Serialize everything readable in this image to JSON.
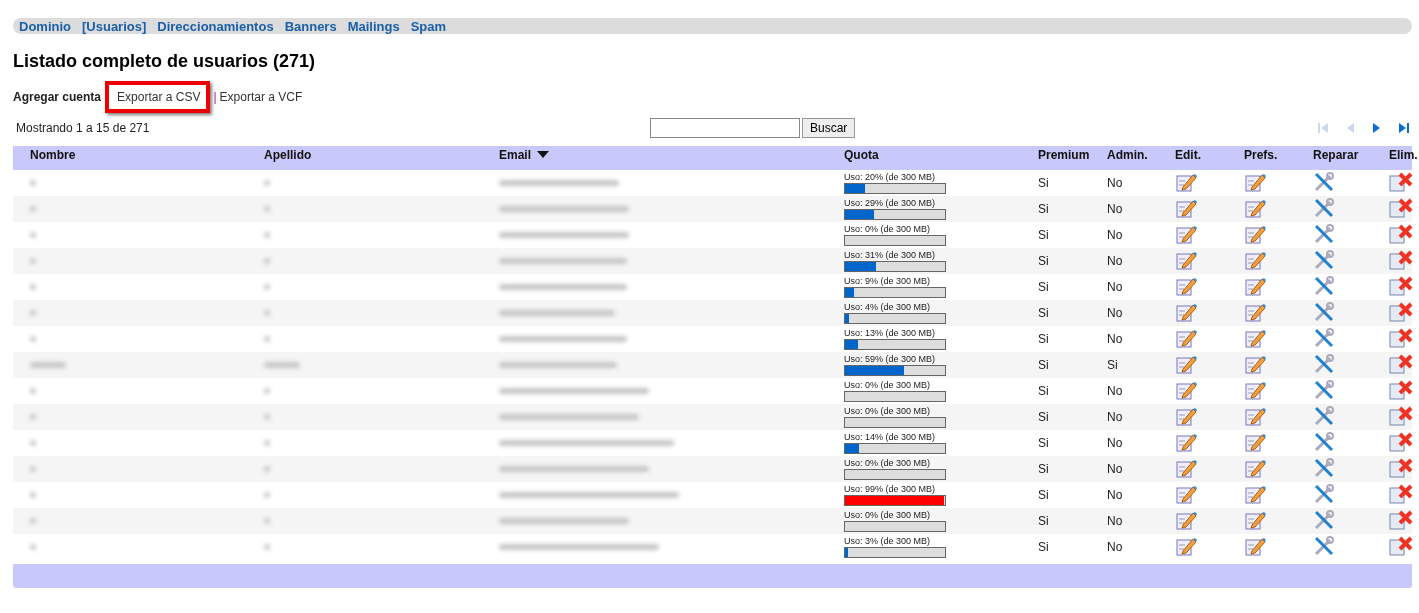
{
  "nav": [
    {
      "label": "Dominio"
    },
    {
      "label": "[Usuarios]"
    },
    {
      "label": "Direccionamientos"
    },
    {
      "label": "Banners"
    },
    {
      "label": "Mailings"
    },
    {
      "label": "Spam"
    }
  ],
  "title": "Listado completo de usuarios (271)",
  "actions": {
    "add": "Agregar cuenta",
    "export_csv": {
      "label": "Exportar a CSV",
      "highlighted": true
    },
    "separator": "|",
    "export_vcf": "Exportar a VCF"
  },
  "showing": "Mostrando 1 a 15 de 271",
  "search": {
    "button": "Buscar"
  },
  "pager": [
    {
      "kind": "first",
      "disabled": true
    },
    {
      "kind": "prev",
      "disabled": true
    },
    {
      "kind": "next",
      "disabled": false
    },
    {
      "kind": "last",
      "disabled": false
    }
  ],
  "table": {
    "columns": [
      {
        "label": "Nombre",
        "sorted": false
      },
      {
        "label": "Apellido",
        "sorted": false
      },
      {
        "label": "Email",
        "sorted": true
      },
      {
        "label": "Quota",
        "sorted": false
      },
      {
        "label": "Premium",
        "sorted": false
      },
      {
        "label": "Admin.",
        "sorted": false
      },
      {
        "label": "Edit.",
        "sorted": false
      },
      {
        "label": "Prefs.",
        "sorted": false
      },
      {
        "label": "Reparar",
        "sorted": false
      },
      {
        "label": "Elim.",
        "sorted": false
      }
    ],
    "rows": [
      {
        "quota": "Uso: 20% (de 300 MB)",
        "level": 0.2,
        "color": "#0066cc",
        "premium": "Si",
        "admin": "No"
      },
      {
        "quota": "Uso: 29% (de 300 MB)",
        "level": 0.29,
        "color": "#0066cc",
        "premium": "Si",
        "admin": "No"
      },
      {
        "quota": "Uso: 0% (de 300 MB)",
        "level": 0,
        "premium": "Si",
        "admin": "No"
      },
      {
        "quota": "Uso: 31% (de 300 MB)",
        "level": 0.31,
        "color": "#0066cc",
        "premium": "Si",
        "admin": "No"
      },
      {
        "quota": "Uso: 9% (de 300 MB)",
        "level": 0.09,
        "color": "#0066cc",
        "premium": "Si",
        "admin": "No"
      },
      {
        "quota": "Uso: 4% (de 300 MB)",
        "level": 0.04,
        "color": "#0066cc",
        "premium": "Si",
        "admin": "No"
      },
      {
        "quota": "Uso: 13% (de 300 MB)",
        "level": 0.13,
        "color": "#0066cc",
        "premium": "Si",
        "admin": "No"
      },
      {
        "quota": "Uso: 59% (de 300 MB)",
        "level": 0.59,
        "color": "#0066cc",
        "premium": "Si",
        "admin": "Si"
      },
      {
        "quota": "Uso: 0% (de 300 MB)",
        "level": 0,
        "premium": "Si",
        "admin": "No"
      },
      {
        "quota": "Uso: 0% (de 300 MB)",
        "level": 0,
        "premium": "Si",
        "admin": "No"
      },
      {
        "quota": "Uso: 14% (de 300 MB)",
        "level": 0.14,
        "color": "#0066cc",
        "premium": "Si",
        "admin": "No"
      },
      {
        "quota": "Uso: 0% (de 300 MB)",
        "level": 0,
        "premium": "Si",
        "admin": "No"
      },
      {
        "quota": "Uso: 99% (de 300 MB)",
        "level": 0.99,
        "color": "#ff0000",
        "premium": "Si",
        "admin": "No"
      },
      {
        "quota": "Uso: 0% (de 300 MB)",
        "level": 0,
        "premium": "Si",
        "admin": "No"
      },
      {
        "quota": "Uso: 3% (de 300 MB)",
        "level": 0.03,
        "color": "#0066cc",
        "premium": "Si",
        "admin": "No"
      }
    ]
  }
}
